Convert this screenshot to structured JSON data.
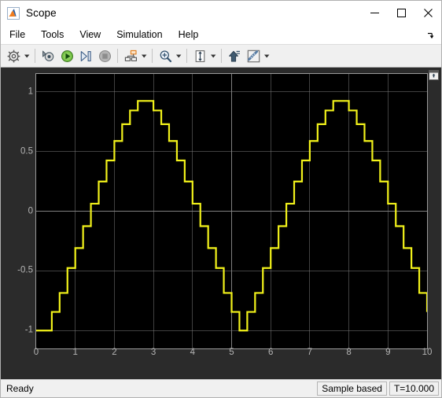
{
  "window": {
    "title": "Scope",
    "app_icon": "matlab-membrane-icon",
    "controls": {
      "minimize": "minimize-icon",
      "maximize": "maximize-icon",
      "close": "close-icon"
    }
  },
  "menubar": {
    "items": [
      {
        "label": "File",
        "name": "menu-file"
      },
      {
        "label": "Tools",
        "name": "menu-tools"
      },
      {
        "label": "View",
        "name": "menu-view"
      },
      {
        "label": "Simulation",
        "name": "menu-simulation"
      },
      {
        "label": "Help",
        "name": "menu-help"
      }
    ],
    "overflow_icon": "overflow-arrow-icon"
  },
  "toolbar": {
    "items": [
      {
        "name": "configuration-properties-button",
        "icon": "gear-icon",
        "tooltip": "Configuration Properties",
        "dropdown": true
      },
      {
        "name": "separator-1",
        "icon": "separator",
        "tooltip": ""
      },
      {
        "name": "run-back-to-start-button",
        "icon": "rewind-icon",
        "tooltip": "Update Diagram",
        "dropdown": false
      },
      {
        "name": "run-button",
        "icon": "play-icon",
        "tooltip": "Run",
        "dropdown": false
      },
      {
        "name": "step-forward-button",
        "icon": "step-forward-icon",
        "tooltip": "Step Forward",
        "dropdown": false
      },
      {
        "name": "stop-button",
        "icon": "stop-icon",
        "tooltip": "Stop",
        "dropdown": false
      },
      {
        "name": "separator-2",
        "icon": "separator",
        "tooltip": ""
      },
      {
        "name": "layout-button",
        "icon": "layout-icon",
        "tooltip": "Layout",
        "dropdown": true
      },
      {
        "name": "separator-3",
        "icon": "separator",
        "tooltip": ""
      },
      {
        "name": "zoom-button",
        "icon": "zoom-in-icon",
        "tooltip": "Zoom In",
        "dropdown": true
      },
      {
        "name": "separator-4",
        "icon": "separator",
        "tooltip": ""
      },
      {
        "name": "autoscale-button",
        "icon": "autoscale-icon",
        "tooltip": "Autoscale",
        "dropdown": true
      },
      {
        "name": "separator-5",
        "icon": "separator",
        "tooltip": ""
      },
      {
        "name": "highlight-signal-button",
        "icon": "highlight-signal-icon",
        "tooltip": "Highlight Signal to Source",
        "dropdown": false
      },
      {
        "name": "cursor-measurements-button",
        "icon": "measurements-ruler-icon",
        "tooltip": "Cursor Measurements",
        "dropdown": true
      }
    ]
  },
  "plot_panel": {
    "maximize_icon": "maximize-panel-icon",
    "background": "#000000",
    "panel_background": "#2b2b2b",
    "grid_color": "#808080",
    "axes_border_color": "#9a9a9a",
    "tick_label_color": "#b4b4b4"
  },
  "statusbar": {
    "status": "Ready",
    "frame_mode": "Sample based",
    "sim_time": "T=10.000"
  },
  "chart_data": {
    "type": "line",
    "title": "",
    "xlabel": "",
    "ylabel": "",
    "xlim": [
      0,
      10
    ],
    "ylim": [
      -1.15,
      1.15
    ],
    "grid": true,
    "legend": null,
    "line_color": "#f2f21a",
    "line_width": 1.2,
    "interpolation": "zero-order-hold-stairs",
    "sample_time": 0.2,
    "xticks": [
      0,
      1,
      2,
      3,
      4,
      5,
      6,
      7,
      8,
      9,
      10
    ],
    "xtick_labels": [
      "0",
      "1",
      "2",
      "3",
      "4",
      "5",
      "6",
      "7",
      "8",
      "9",
      "10"
    ],
    "yticks": [
      -1,
      -0.5,
      0,
      0.5,
      1
    ],
    "ytick_labels": [
      "-1",
      "-0.5",
      "0",
      "0.5",
      "1"
    ],
    "series": [
      {
        "name": "signal-1",
        "color": "#f2f21a",
        "x": [
          0,
          0.2,
          0.4,
          0.6,
          0.8,
          1,
          1.2,
          1.4,
          1.6,
          1.8,
          2,
          2.2,
          2.4,
          2.6,
          2.8,
          3,
          3.2,
          3.4,
          3.6,
          3.8,
          4,
          4.2,
          4.4,
          4.6,
          4.8,
          5,
          5.2,
          5.4,
          5.6,
          5.8,
          6,
          6.2,
          6.4,
          6.6,
          6.8,
          7,
          7.2,
          7.4,
          7.6,
          7.8,
          8,
          8.2,
          8.4,
          8.6,
          8.8,
          9,
          9.2,
          9.4,
          9.6,
          9.8,
          10
        ],
        "y": [
          -1,
          -1,
          -0.844,
          -0.685,
          -0.476,
          -0.309,
          -0.125,
          0.063,
          0.249,
          0.425,
          0.588,
          0.729,
          0.844,
          0.924,
          0.924,
          0.844,
          0.729,
          0.588,
          0.425,
          0.249,
          0.063,
          -0.125,
          -0.309,
          -0.476,
          -0.685,
          -0.844,
          -1,
          -0.844,
          -0.685,
          -0.476,
          -0.309,
          -0.125,
          0.063,
          0.249,
          0.425,
          0.588,
          0.729,
          0.844,
          0.924,
          0.924,
          0.844,
          0.729,
          0.588,
          0.425,
          0.249,
          0.063,
          -0.125,
          -0.309,
          -0.476,
          -0.685,
          -0.844
        ]
      }
    ]
  }
}
